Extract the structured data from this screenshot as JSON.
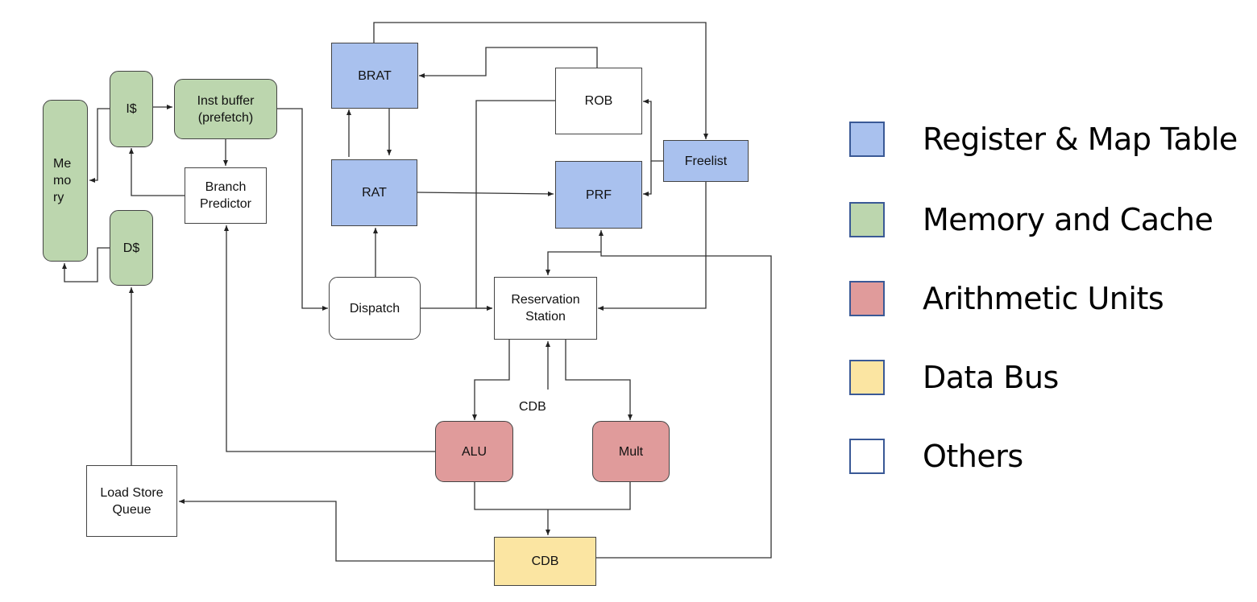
{
  "colors": {
    "register_map_table": "#a9c1ee",
    "memory_cache": "#bcd6ae",
    "arithmetic": "#e09b9b",
    "data_bus": "#fbe5a2",
    "others": "#ffffff",
    "line": "#333333",
    "legend_border": "#3a5996"
  },
  "nodes": {
    "memory": "Me\nmo\nry",
    "icache": "I$",
    "dcache": "D$",
    "inst_buffer": "Inst buffer\n(prefetch)",
    "branch_predictor": "Branch\nPredictor",
    "brat": "BRAT",
    "rat": "RAT",
    "rob": "ROB",
    "prf": "PRF",
    "freelist": "Freelist",
    "dispatch": "Dispatch",
    "reservation_station": "Reservation\nStation",
    "alu": "ALU",
    "mult": "Mult",
    "cdb": "CDB",
    "load_store_queue": "Load Store\nQueue"
  },
  "labels": {
    "cdb_edge": "CDB"
  },
  "edges": [
    {
      "from": "icache",
      "to": "inst_buffer"
    },
    {
      "from": "icache",
      "to": "memory"
    },
    {
      "from": "dcache",
      "to": "memory"
    },
    {
      "from": "inst_buffer",
      "to": "branch_predictor"
    },
    {
      "from": "branch_predictor",
      "to": "icache"
    },
    {
      "from": "inst_buffer",
      "to": "dispatch"
    },
    {
      "from": "dispatch",
      "to": "rat"
    },
    {
      "from": "dispatch",
      "to": "reservation_station"
    },
    {
      "from": "rat",
      "to": "brat"
    },
    {
      "from": "brat",
      "to": "rat"
    },
    {
      "from": "rat",
      "to": "prf"
    },
    {
      "from": "rob",
      "to": "brat"
    },
    {
      "from": "brat",
      "to": "freelist"
    },
    {
      "from": "rob",
      "to": "reservation_station"
    },
    {
      "from": "freelist",
      "to": "rob"
    },
    {
      "from": "freelist",
      "to": "prf"
    },
    {
      "from": "freelist",
      "to": "reservation_station"
    },
    {
      "from": "cdb",
      "to": "prf"
    },
    {
      "from": "cdb",
      "to": "reservation_station"
    },
    {
      "from": "reservation_station",
      "to": "alu"
    },
    {
      "from": "reservation_station",
      "to": "mult"
    },
    {
      "from": "alu",
      "to": "cdb"
    },
    {
      "from": "mult",
      "to": "cdb"
    },
    {
      "from": "alu",
      "to": "branch_predictor"
    },
    {
      "from": "cdb",
      "to": "load_store_queue"
    },
    {
      "from": "load_store_queue",
      "to": "dcache"
    }
  ],
  "legend": [
    {
      "label": "Register & Map Table",
      "color": "#a9c1ee"
    },
    {
      "label": "Memory and Cache",
      "color": "#bcd6ae"
    },
    {
      "label": "Arithmetic Units",
      "color": "#e09b9b"
    },
    {
      "label": "Data Bus",
      "color": "#fbe5a2"
    },
    {
      "label": "Others",
      "color": "#ffffff"
    }
  ]
}
